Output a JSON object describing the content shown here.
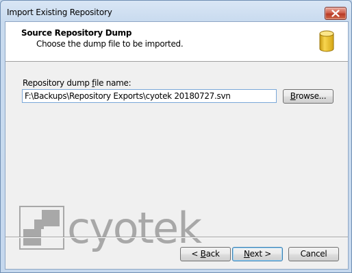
{
  "window": {
    "title": "Import Existing Repository",
    "close_icon": "close-icon"
  },
  "header": {
    "title": "Source Repository Dump",
    "subtitle": "Choose the dump file to be imported.",
    "icon": "database-icon"
  },
  "form": {
    "label_prefix": "Repository dump ",
    "label_accel": "f",
    "label_suffix": "ile name:",
    "path_value": "F:\\Backups\\Repository Exports\\cyotek 20180727.svn",
    "browse_prefix": "",
    "browse_accel": "B",
    "browse_suffix": "rowse..."
  },
  "branding": {
    "logo_text": "cyotek"
  },
  "footer": {
    "back_prefix": "< ",
    "back_accel": "B",
    "back_suffix": "ack",
    "next_accel": "N",
    "next_suffix": "ext >",
    "cancel_label": "Cancel"
  },
  "colors": {
    "logo_gray": "#a8a8a8",
    "db_icon": "#f0c020",
    "default_button_border": "#3c7fb1"
  }
}
